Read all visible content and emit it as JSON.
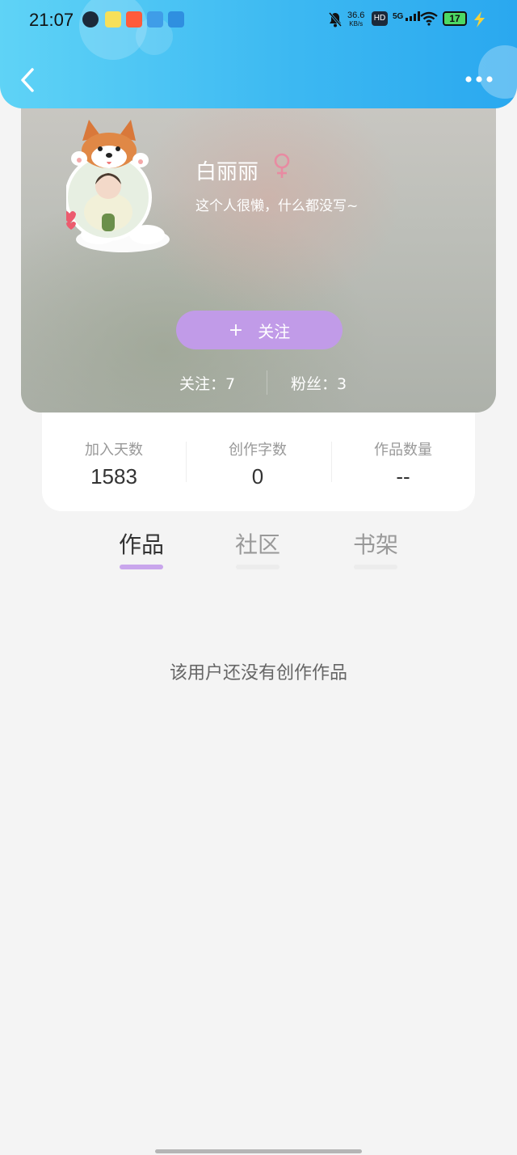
{
  "status_bar": {
    "time": "21:07",
    "net_speed_value": "36.6",
    "net_speed_unit": "KB/s",
    "hd_label": "HD",
    "network_label": "5G",
    "battery": "17"
  },
  "profile": {
    "nickname": "白丽丽",
    "bio": "这个人很懒，什么都没写~",
    "follow_button_icon": "+",
    "follow_button_label": "关注",
    "following_text": "关注：7",
    "fans_text": "粉丝：3"
  },
  "stats": [
    {
      "label": "加入天数",
      "value": "1583"
    },
    {
      "label": "创作字数",
      "value": "0"
    },
    {
      "label": "作品数量",
      "value": "--"
    }
  ],
  "tabs": [
    {
      "label": "作品",
      "active": true
    },
    {
      "label": "社区",
      "active": false
    },
    {
      "label": "书架",
      "active": false
    }
  ],
  "empty_state": "该用户还没有创作作品",
  "colors": {
    "header_gradient_start": "#5fd3f6",
    "header_gradient_end": "#2aa8ef",
    "follow_button": "#c19be8",
    "tab_indicator_active": "#c9a6ec",
    "gender_female": "#e88ba2"
  },
  "icons": {
    "back": "chevron-left-icon",
    "more": "more-dots-icon",
    "gender": "female-icon"
  }
}
